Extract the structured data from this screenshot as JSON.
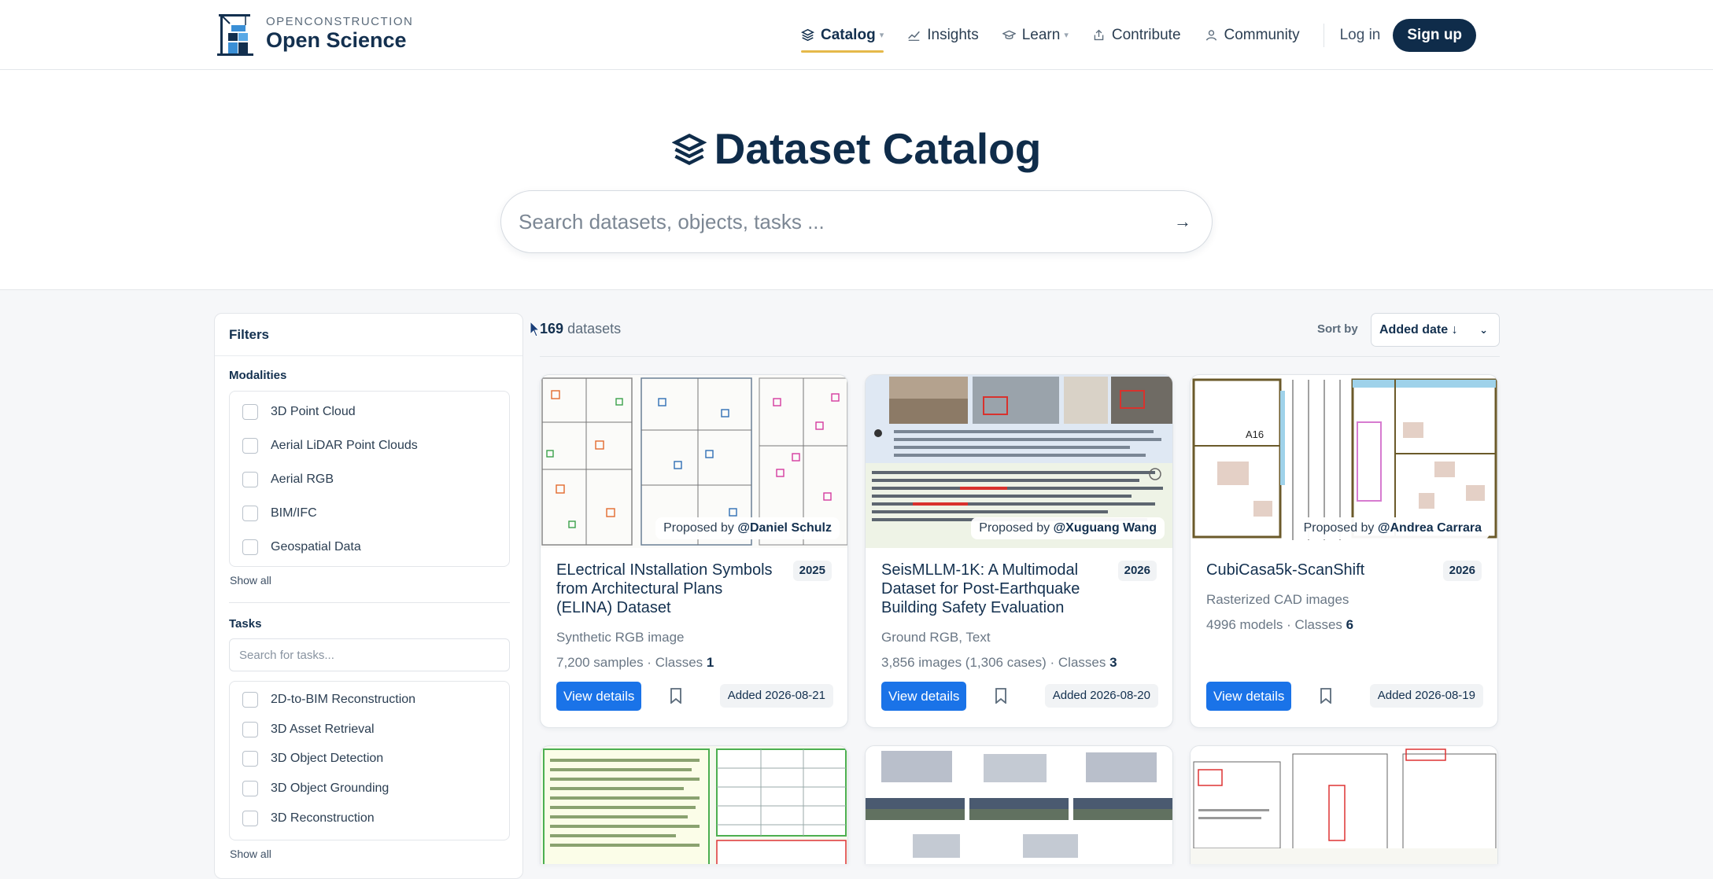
{
  "brand": {
    "top": "OPENCONSTRUCTION",
    "bottom": "Open Science"
  },
  "nav": {
    "items": [
      {
        "label": "Catalog",
        "icon": "layers-icon",
        "active": true,
        "dropdown": true
      },
      {
        "label": "Insights",
        "icon": "chart-line-icon",
        "active": false,
        "dropdown": false
      },
      {
        "label": "Learn",
        "icon": "graduation-cap-icon",
        "active": false,
        "dropdown": true
      },
      {
        "label": "Contribute",
        "icon": "upload-icon",
        "active": false,
        "dropdown": false
      },
      {
        "label": "Community",
        "icon": "user-icon",
        "active": false,
        "dropdown": false
      }
    ],
    "login": "Log in",
    "signup": "Sign up"
  },
  "hero": {
    "title": "Dataset Catalog",
    "search_placeholder": "Search datasets, objects, tasks ..."
  },
  "filters": {
    "title": "Filters",
    "modalities_title": "Modalities",
    "modalities": [
      "3D Point Cloud",
      "Aerial LiDAR Point Clouds",
      "Aerial RGB",
      "BIM/IFC",
      "Geospatial Data"
    ],
    "show_all": "Show all",
    "tasks_title": "Tasks",
    "tasks_placeholder": "Search for tasks...",
    "tasks": [
      "2D-to-BIM Reconstruction",
      "3D Asset Retrieval",
      "3D Object Detection",
      "3D Object Grounding",
      "3D Reconstruction"
    ]
  },
  "results": {
    "count": "169",
    "count_suffix": "datasets",
    "sort_label": "Sort by",
    "sort_value": "Added date ↓"
  },
  "cards": [
    {
      "proposed_prefix": "Proposed by",
      "author": "@Daniel Schulz",
      "title": "ELectrical INstallation Symbols from Architectural Plans (ELINA) Dataset",
      "year": "2025",
      "modality": "Synthetic RGB image",
      "samples": "7,200 samples",
      "classes_label": "Classes",
      "classes": "1",
      "view": "View details",
      "added": "Added 2026-08-21"
    },
    {
      "proposed_prefix": "Proposed by",
      "author": "@Xuguang Wang",
      "title": "SeisMLLM-1K: A Multimodal Dataset for Post-Earthquake Building Safety Evaluation",
      "year": "2026",
      "modality": "Ground RGB, Text",
      "samples": "3,856 images (1,306 cases)",
      "classes_label": "Classes",
      "classes": "3",
      "view": "View details",
      "added": "Added 2026-08-20"
    },
    {
      "proposed_prefix": "Proposed by",
      "author": "@Andrea Carrara",
      "title": "CubiCasa5k-ScanShift",
      "year": "2026",
      "modality": "Rasterized CAD images",
      "samples": "4996 models",
      "classes_label": "Classes",
      "classes": "6",
      "view": "View details",
      "added": "Added 2026-08-19"
    }
  ],
  "colors": {
    "navy": "#0f2c4a",
    "accent": "#e5b94a",
    "primary": "#1a73e8"
  }
}
